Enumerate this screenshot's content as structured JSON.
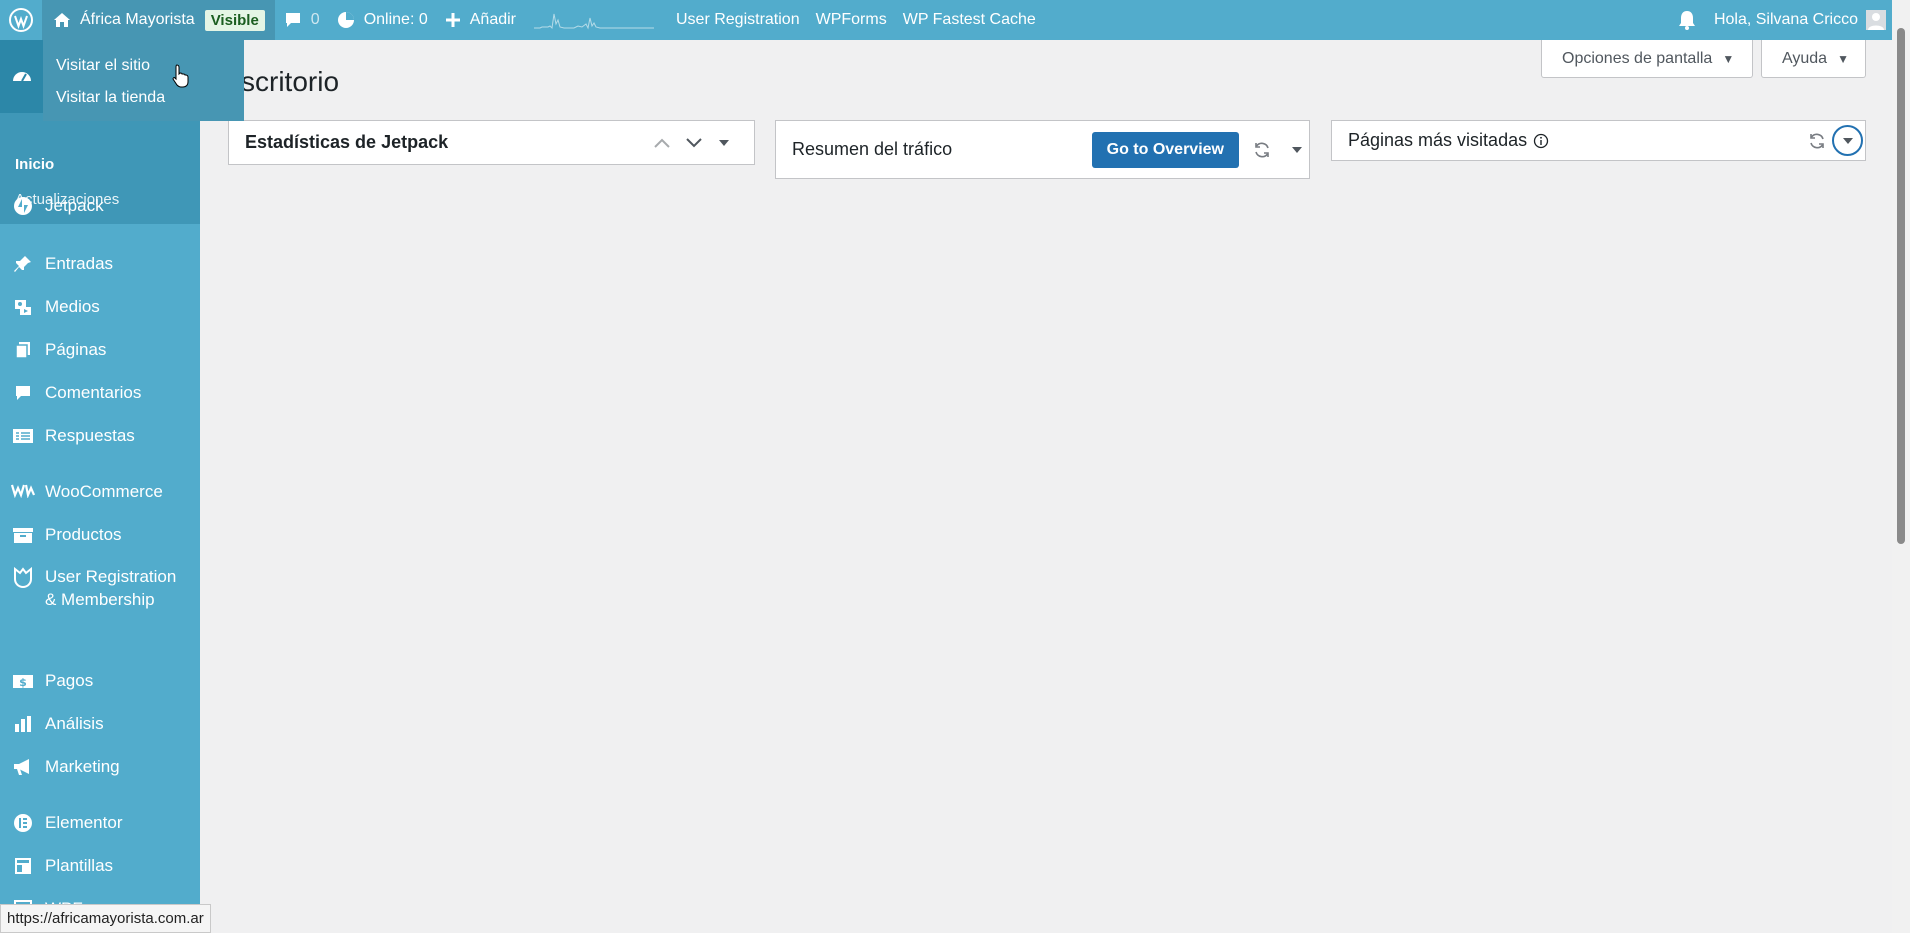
{
  "adminbar": {
    "site_name": "África Mayorista",
    "visibility_badge": "Visible",
    "comments_count": "0",
    "online_label": "Online: 0",
    "add_label": "Añadir",
    "links": [
      "User Registration",
      "WPForms",
      "WP Fastest Cache"
    ],
    "greeting": "Hola, Silvana Cricco"
  },
  "site_dropdown": {
    "items": [
      "Visitar el sitio",
      "Visitar la tienda"
    ]
  },
  "sidebar": {
    "submenu": {
      "inicio": "Inicio",
      "updates": "Actualizaciones"
    },
    "items": [
      {
        "label": "Jetpack",
        "icon": "jetpack-icon"
      },
      {
        "label": "Entradas",
        "icon": "pin-icon"
      },
      {
        "label": "Medios",
        "icon": "media-icon"
      },
      {
        "label": "Páginas",
        "icon": "pages-icon"
      },
      {
        "label": "Comentarios",
        "icon": "comment-icon"
      },
      {
        "label": "Respuestas",
        "icon": "responses-icon"
      },
      {
        "label": "WooCommerce",
        "icon": "woo-icon"
      },
      {
        "label": "Productos",
        "icon": "products-icon"
      },
      {
        "label": "User Registration & Membership",
        "icon": "user-registration-icon"
      },
      {
        "label": "Pagos",
        "icon": "payments-icon"
      },
      {
        "label": "Análisis",
        "icon": "analytics-icon"
      },
      {
        "label": "Marketing",
        "icon": "megaphone-icon"
      },
      {
        "label": "Elementor",
        "icon": "elementor-icon"
      },
      {
        "label": "Plantillas",
        "icon": "templates-icon"
      },
      {
        "label": "WPForms",
        "icon": "wpforms-icon"
      }
    ]
  },
  "header": {
    "screen_options": "Opciones de pantalla",
    "help": "Ayuda",
    "page_title": "scritorio"
  },
  "widgets": {
    "jetpack_stats": "Estadísticas de Jetpack",
    "traffic_summary": "Resumen del tráfico",
    "go_overview": "Go to Overview",
    "top_pages": "Páginas más visitadas"
  },
  "status_url": "https://africamayorista.com.ar",
  "colors": {
    "adminbar": "#52accc",
    "sidebar": "#52accc",
    "submenu": "#3f97b7",
    "primary_button": "#2271b1",
    "badge_bg": "#e4f5e5"
  }
}
